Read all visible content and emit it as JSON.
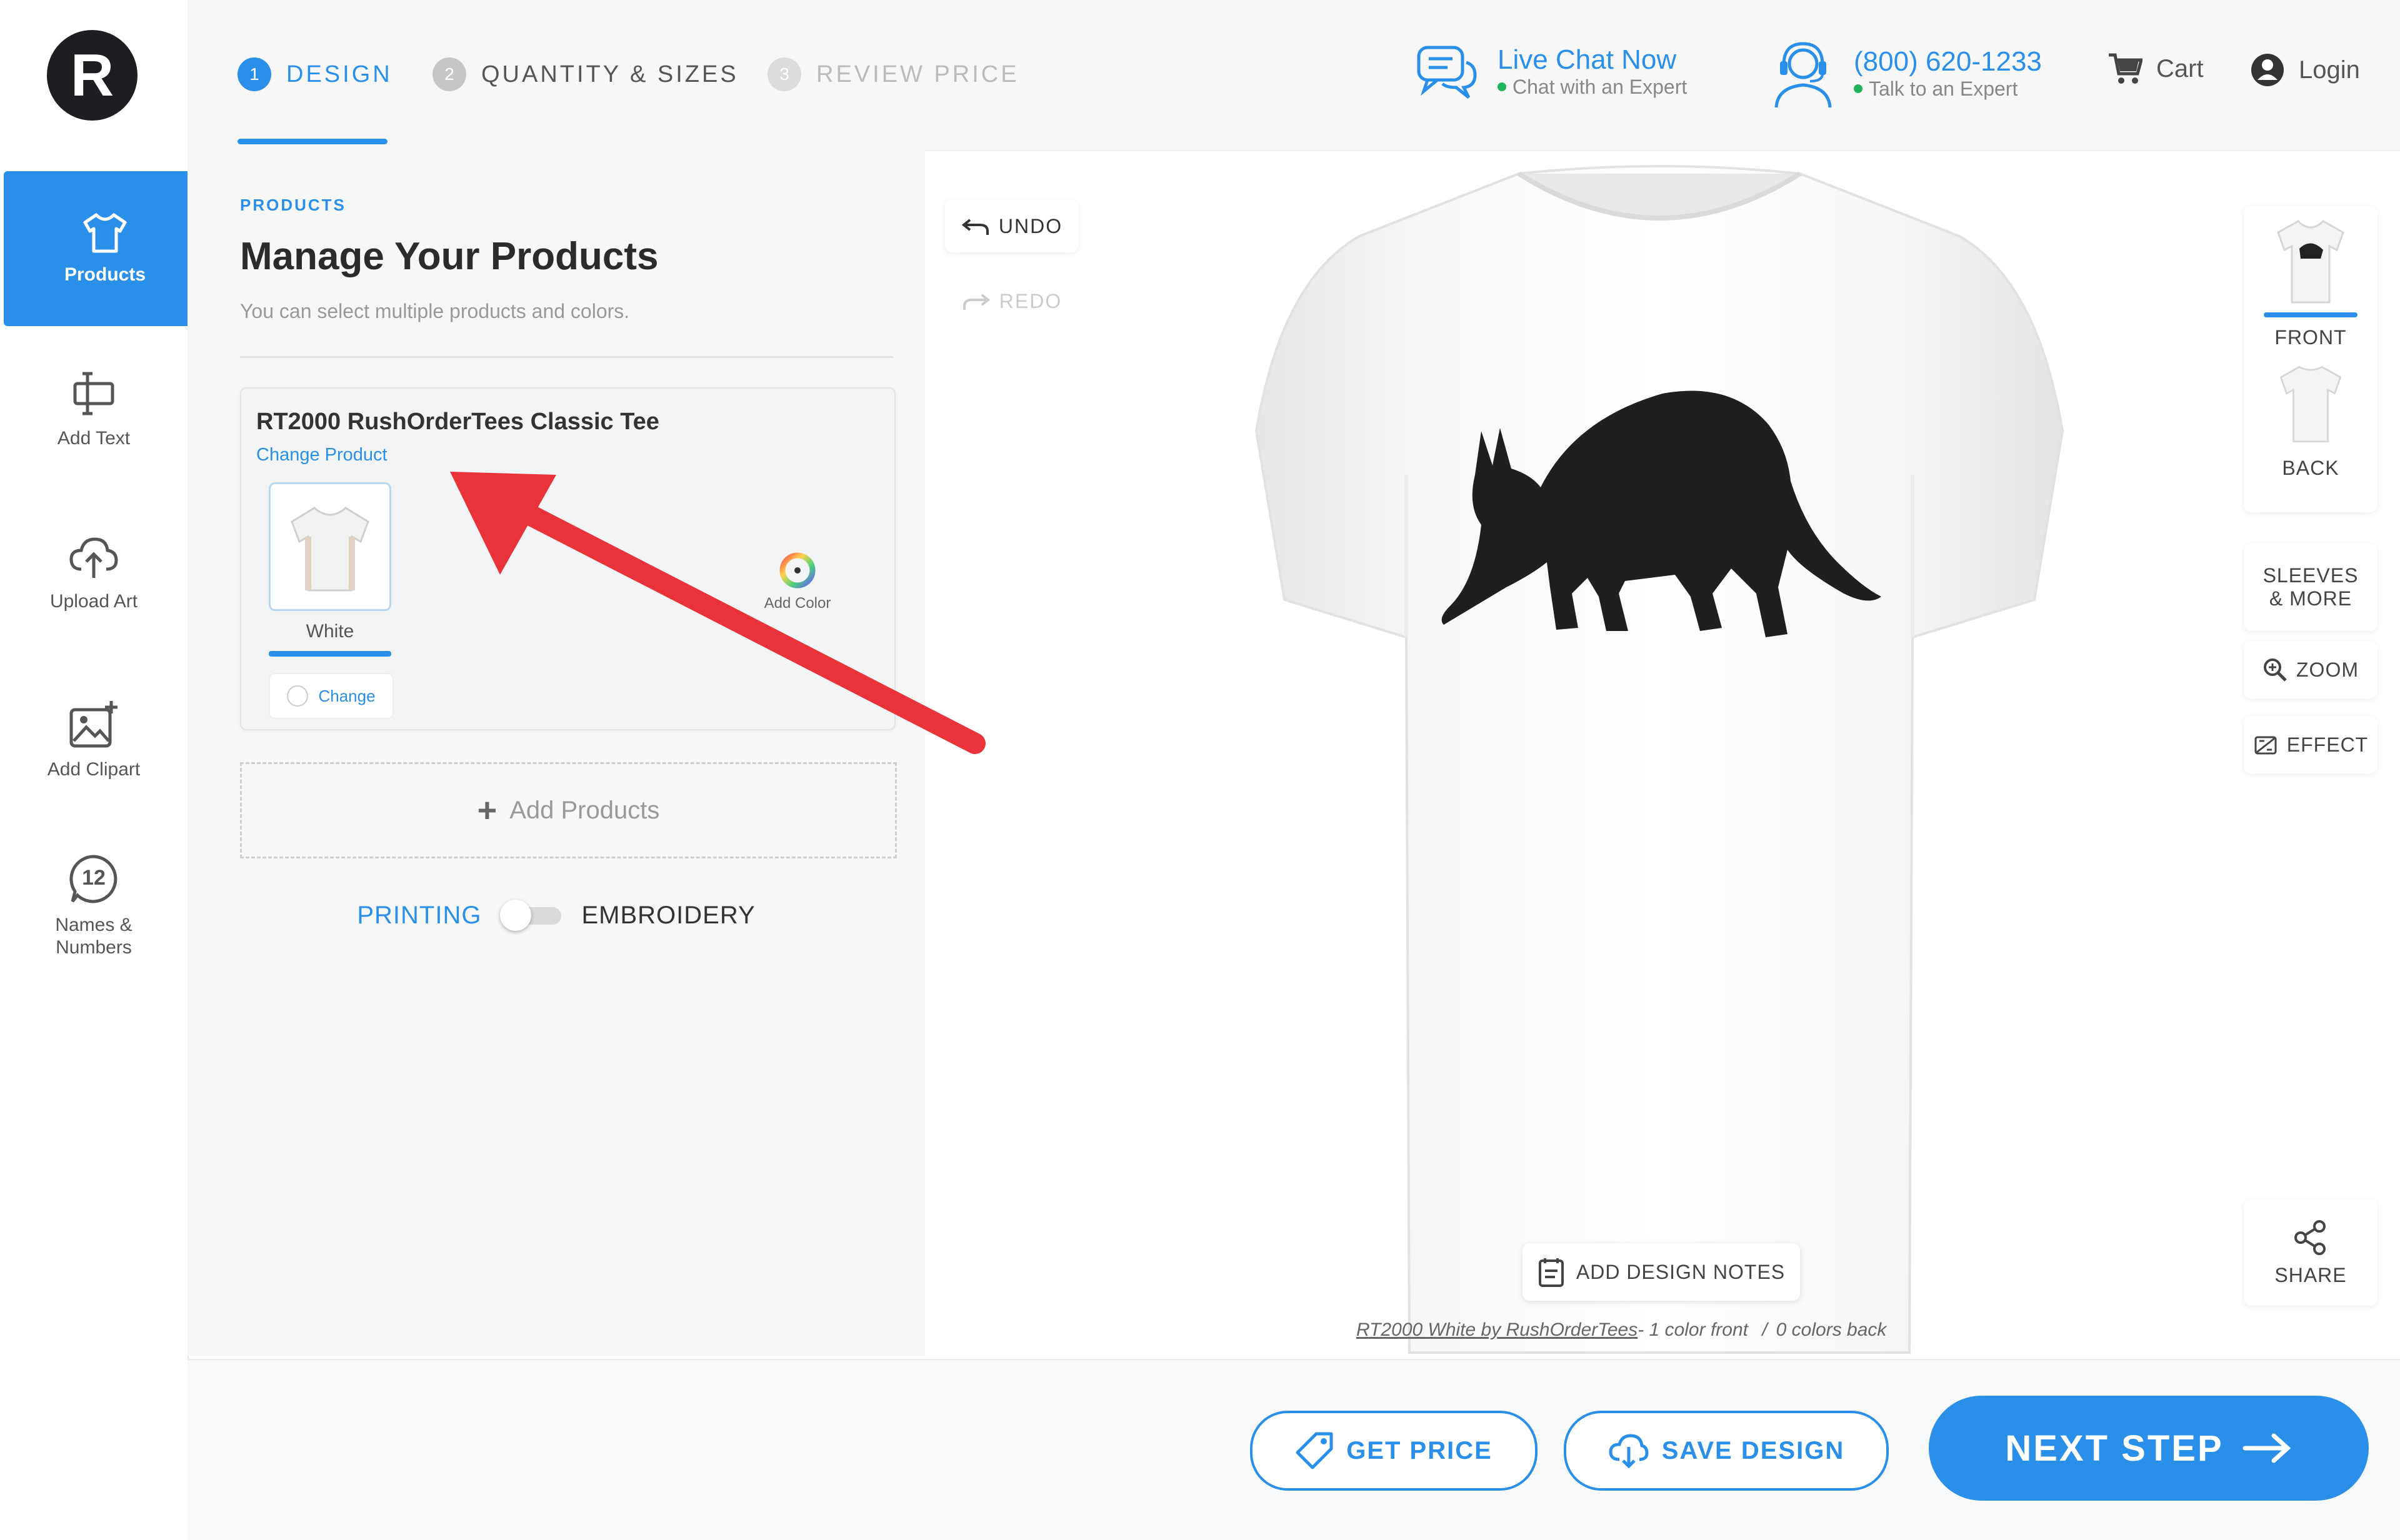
{
  "brand": {
    "logo_letter": "R"
  },
  "rail": {
    "items": [
      {
        "label": "Products",
        "icon": "tshirt-icon",
        "active": true
      },
      {
        "label": "Add Text",
        "icon": "text-icon"
      },
      {
        "label": "Upload Art",
        "icon": "upload-cloud-icon"
      },
      {
        "label": "Add Clipart",
        "icon": "clipart-image-icon"
      },
      {
        "label": "Names &\nNumbers",
        "icon": "number-badge-icon",
        "badge": "12"
      }
    ]
  },
  "steps": [
    {
      "num": "1",
      "label": "DESIGN",
      "state": "active"
    },
    {
      "num": "2",
      "label": "QUANTITY & SIZES",
      "state": "next"
    },
    {
      "num": "3",
      "label": "REVIEW PRICE",
      "state": "disabled"
    }
  ],
  "header": {
    "chat": {
      "title": "Live Chat Now",
      "subtitle": "Chat with an Expert"
    },
    "phone": {
      "number": "(800) 620-1233",
      "subtitle": "Talk to an Expert"
    },
    "cart": "Cart",
    "login": "Login"
  },
  "panel": {
    "crumb": "PRODUCTS",
    "title": "Manage Your Products",
    "subtitle": "You can select multiple products and colors.",
    "product": {
      "name": "RT2000 RushOrderTees Classic Tee",
      "change_product": "Change Product",
      "color_label": "White",
      "change_label": "Change",
      "add_color": "Add Color"
    },
    "add_products": "Add Products",
    "mode_left": "PRINTING",
    "mode_right": "EMBROIDERY"
  },
  "canvas": {
    "undo": "UNDO",
    "redo": "REDO",
    "add_design_notes": "ADD DESIGN NOTES",
    "caption_link": "RT2000 White by RushOrderTees",
    "caption_front": "- 1 color front",
    "caption_sep": "/",
    "caption_back": "0 colors back"
  },
  "views": {
    "front": "FRONT",
    "back": "BACK",
    "sleeves": "SLEEVES\n& MORE",
    "zoom": "ZOOM",
    "effect": "EFFECT",
    "share": "SHARE"
  },
  "footer": {
    "get_price": "GET PRICE",
    "save_design": "SAVE DESIGN",
    "next_step": "NEXT STEP"
  },
  "colors": {
    "accent": "#2a8fe8",
    "online": "#1fb35a",
    "annotation_arrow": "#e8333a"
  }
}
